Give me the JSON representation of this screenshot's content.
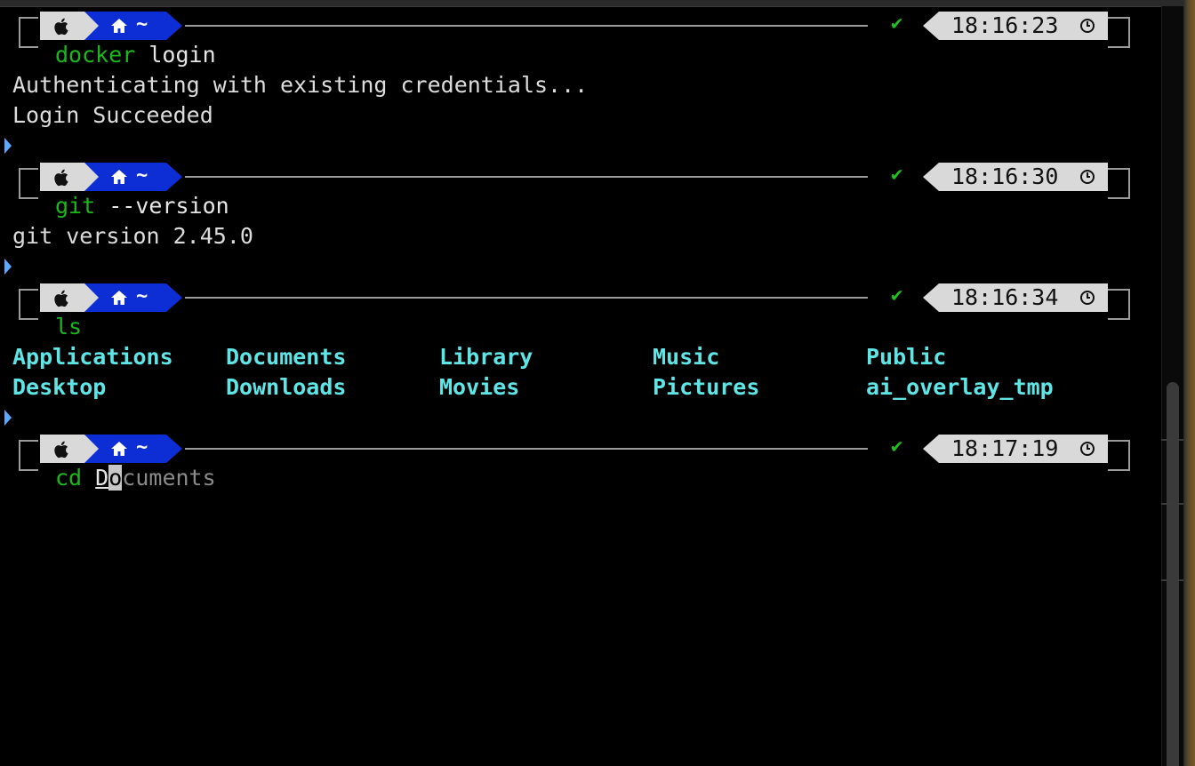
{
  "prompts": [
    {
      "command": "docker",
      "args": "login",
      "time": "18:16:23",
      "output": [
        "Authenticating with existing credentials...",
        "Login Succeeded"
      ]
    },
    {
      "command": "git",
      "args": "--version",
      "time": "18:16:30",
      "output": [
        "git version 2.45.0"
      ]
    },
    {
      "command": "ls",
      "args": "",
      "time": "18:16:34",
      "listing": [
        "Applications",
        "Documents",
        "Library",
        "Music",
        "Public",
        "Desktop",
        "Downloads",
        "Movies",
        "Pictures",
        "ai_overlay_tmp"
      ]
    },
    {
      "command": "cd",
      "typed": "D",
      "cursor_char": "o",
      "suggestion": "cuments",
      "time": "18:17:19"
    }
  ],
  "prompt_segments": {
    "os_icon": "apple-icon",
    "dir_icon": "home-icon",
    "dir_label": "~",
    "status_mark": "✔",
    "time_icon": "clock-icon"
  },
  "colors": {
    "background": "#000000",
    "command": "#1ab81a",
    "directory_listing": "#5fe5e5",
    "dir_segment": "#0c2ed4",
    "segment_light": "#d9d9d9",
    "status_ok": "#1fc01f",
    "prompt_marker": "#5aa9ff"
  }
}
